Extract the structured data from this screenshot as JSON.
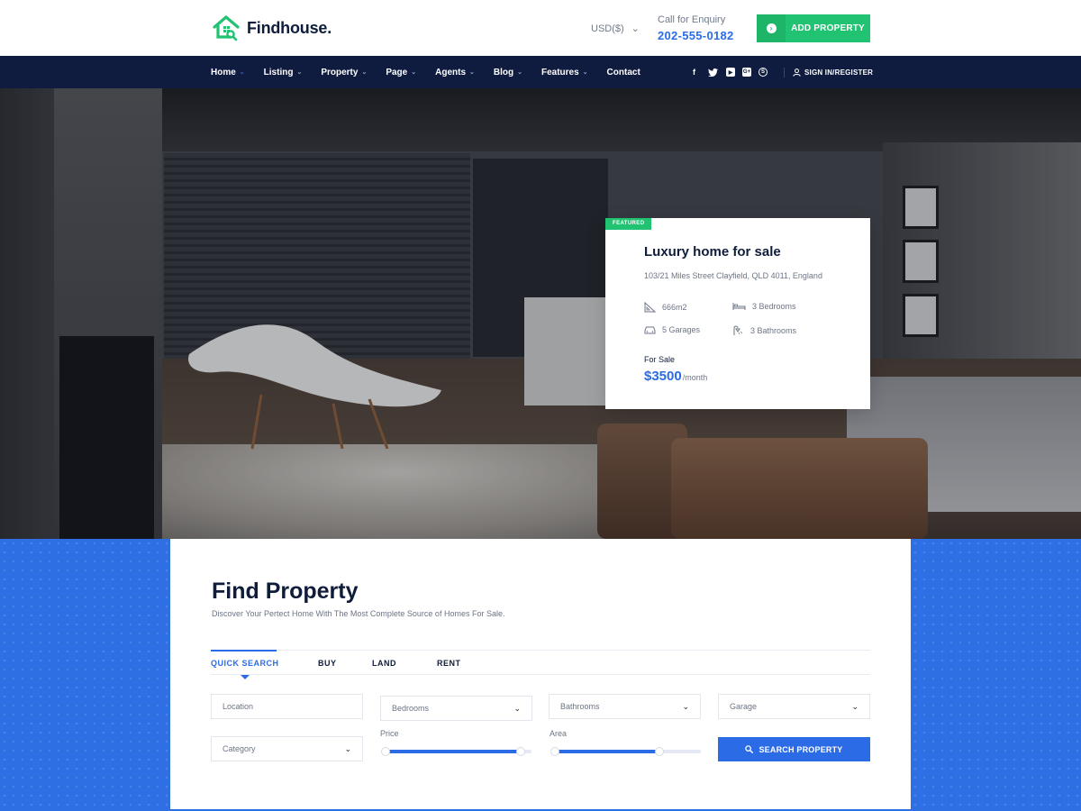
{
  "brand": {
    "name": "Findhouse."
  },
  "header": {
    "currency": "USD($)",
    "enquiry_label": "Call for Enquiry",
    "enquiry_phone": "202-555-0182",
    "add_property": "ADD PROPERTY"
  },
  "nav": {
    "items": [
      {
        "label": "Home",
        "dropdown": true,
        "active": true
      },
      {
        "label": "Listing",
        "dropdown": true
      },
      {
        "label": "Property",
        "dropdown": true
      },
      {
        "label": "Page",
        "dropdown": true
      },
      {
        "label": "Agents",
        "dropdown": true
      },
      {
        "label": "Blog",
        "dropdown": true
      },
      {
        "label": "Features",
        "dropdown": true
      },
      {
        "label": "Contact",
        "dropdown": false
      }
    ],
    "social_icons": [
      "facebook-icon",
      "twitter-icon",
      "youtube-icon",
      "google-plus-icon",
      "skype-icon"
    ],
    "sign_in": "SIGN IN/REGISTER"
  },
  "featured_card": {
    "tag": "FEATURED",
    "title": "Luxury home for sale",
    "address": "103/21 Miles Street Clayfield, QLD 4011, England",
    "area": "666m2",
    "bedrooms": "3 Bedrooms",
    "garages": "5 Garages",
    "bathrooms": "3 Bathrooms",
    "status": "For Sale",
    "price": "$3500",
    "price_period": "/month"
  },
  "search": {
    "title": "Find Property",
    "subtitle": "Discover Your Pertect Home With The Most Complete Source of Homes For Sale.",
    "tabs": [
      "QUICK SEARCH",
      "BUY",
      "LAND",
      "RENT"
    ],
    "active_tab": "QUICK SEARCH",
    "location_placeholder": "Location",
    "bedrooms": "Bedrooms",
    "bathrooms": "Bathrooms",
    "garage": "Garage",
    "category": "Category",
    "price_label": "Price",
    "area_label": "Area",
    "price_range_fill": 0.93,
    "area_range_fill": 0.72,
    "search_button": "SEARCH PROPERTY"
  },
  "colors": {
    "primary_blue": "#2b6ce6",
    "green": "#21c272",
    "navy": "#0f1c3f"
  }
}
